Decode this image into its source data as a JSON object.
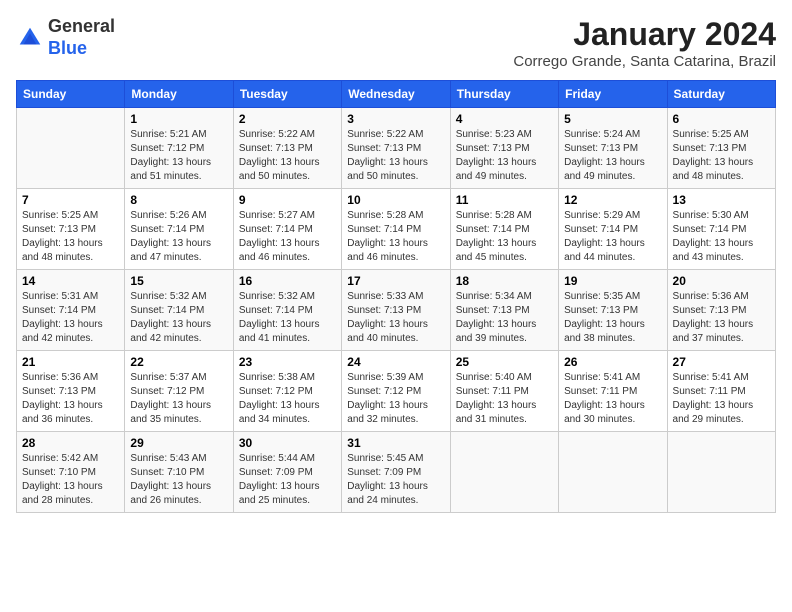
{
  "header": {
    "logo_general": "General",
    "logo_blue": "Blue",
    "month_title": "January 2024",
    "location": "Corrego Grande, Santa Catarina, Brazil"
  },
  "weekdays": [
    "Sunday",
    "Monday",
    "Tuesday",
    "Wednesday",
    "Thursday",
    "Friday",
    "Saturday"
  ],
  "weeks": [
    [
      {
        "day": "",
        "info": ""
      },
      {
        "day": "1",
        "info": "Sunrise: 5:21 AM\nSunset: 7:12 PM\nDaylight: 13 hours\nand 51 minutes."
      },
      {
        "day": "2",
        "info": "Sunrise: 5:22 AM\nSunset: 7:13 PM\nDaylight: 13 hours\nand 50 minutes."
      },
      {
        "day": "3",
        "info": "Sunrise: 5:22 AM\nSunset: 7:13 PM\nDaylight: 13 hours\nand 50 minutes."
      },
      {
        "day": "4",
        "info": "Sunrise: 5:23 AM\nSunset: 7:13 PM\nDaylight: 13 hours\nand 49 minutes."
      },
      {
        "day": "5",
        "info": "Sunrise: 5:24 AM\nSunset: 7:13 PM\nDaylight: 13 hours\nand 49 minutes."
      },
      {
        "day": "6",
        "info": "Sunrise: 5:25 AM\nSunset: 7:13 PM\nDaylight: 13 hours\nand 48 minutes."
      }
    ],
    [
      {
        "day": "7",
        "info": "Sunrise: 5:25 AM\nSunset: 7:13 PM\nDaylight: 13 hours\nand 48 minutes."
      },
      {
        "day": "8",
        "info": "Sunrise: 5:26 AM\nSunset: 7:14 PM\nDaylight: 13 hours\nand 47 minutes."
      },
      {
        "day": "9",
        "info": "Sunrise: 5:27 AM\nSunset: 7:14 PM\nDaylight: 13 hours\nand 46 minutes."
      },
      {
        "day": "10",
        "info": "Sunrise: 5:28 AM\nSunset: 7:14 PM\nDaylight: 13 hours\nand 46 minutes."
      },
      {
        "day": "11",
        "info": "Sunrise: 5:28 AM\nSunset: 7:14 PM\nDaylight: 13 hours\nand 45 minutes."
      },
      {
        "day": "12",
        "info": "Sunrise: 5:29 AM\nSunset: 7:14 PM\nDaylight: 13 hours\nand 44 minutes."
      },
      {
        "day": "13",
        "info": "Sunrise: 5:30 AM\nSunset: 7:14 PM\nDaylight: 13 hours\nand 43 minutes."
      }
    ],
    [
      {
        "day": "14",
        "info": "Sunrise: 5:31 AM\nSunset: 7:14 PM\nDaylight: 13 hours\nand 42 minutes."
      },
      {
        "day": "15",
        "info": "Sunrise: 5:32 AM\nSunset: 7:14 PM\nDaylight: 13 hours\nand 42 minutes."
      },
      {
        "day": "16",
        "info": "Sunrise: 5:32 AM\nSunset: 7:14 PM\nDaylight: 13 hours\nand 41 minutes."
      },
      {
        "day": "17",
        "info": "Sunrise: 5:33 AM\nSunset: 7:13 PM\nDaylight: 13 hours\nand 40 minutes."
      },
      {
        "day": "18",
        "info": "Sunrise: 5:34 AM\nSunset: 7:13 PM\nDaylight: 13 hours\nand 39 minutes."
      },
      {
        "day": "19",
        "info": "Sunrise: 5:35 AM\nSunset: 7:13 PM\nDaylight: 13 hours\nand 38 minutes."
      },
      {
        "day": "20",
        "info": "Sunrise: 5:36 AM\nSunset: 7:13 PM\nDaylight: 13 hours\nand 37 minutes."
      }
    ],
    [
      {
        "day": "21",
        "info": "Sunrise: 5:36 AM\nSunset: 7:13 PM\nDaylight: 13 hours\nand 36 minutes."
      },
      {
        "day": "22",
        "info": "Sunrise: 5:37 AM\nSunset: 7:12 PM\nDaylight: 13 hours\nand 35 minutes."
      },
      {
        "day": "23",
        "info": "Sunrise: 5:38 AM\nSunset: 7:12 PM\nDaylight: 13 hours\nand 34 minutes."
      },
      {
        "day": "24",
        "info": "Sunrise: 5:39 AM\nSunset: 7:12 PM\nDaylight: 13 hours\nand 32 minutes."
      },
      {
        "day": "25",
        "info": "Sunrise: 5:40 AM\nSunset: 7:11 PM\nDaylight: 13 hours\nand 31 minutes."
      },
      {
        "day": "26",
        "info": "Sunrise: 5:41 AM\nSunset: 7:11 PM\nDaylight: 13 hours\nand 30 minutes."
      },
      {
        "day": "27",
        "info": "Sunrise: 5:41 AM\nSunset: 7:11 PM\nDaylight: 13 hours\nand 29 minutes."
      }
    ],
    [
      {
        "day": "28",
        "info": "Sunrise: 5:42 AM\nSunset: 7:10 PM\nDaylight: 13 hours\nand 28 minutes."
      },
      {
        "day": "29",
        "info": "Sunrise: 5:43 AM\nSunset: 7:10 PM\nDaylight: 13 hours\nand 26 minutes."
      },
      {
        "day": "30",
        "info": "Sunrise: 5:44 AM\nSunset: 7:09 PM\nDaylight: 13 hours\nand 25 minutes."
      },
      {
        "day": "31",
        "info": "Sunrise: 5:45 AM\nSunset: 7:09 PM\nDaylight: 13 hours\nand 24 minutes."
      },
      {
        "day": "",
        "info": ""
      },
      {
        "day": "",
        "info": ""
      },
      {
        "day": "",
        "info": ""
      }
    ]
  ]
}
